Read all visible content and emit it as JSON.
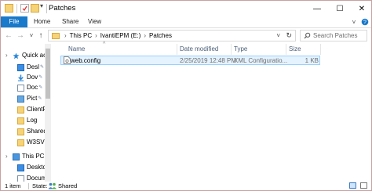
{
  "window": {
    "title": "Patches",
    "minimize": "—",
    "maximize": "☐",
    "close": "✕"
  },
  "ribbon": {
    "tabs": [
      "File",
      "Home",
      "Share",
      "View"
    ]
  },
  "address": {
    "back": "←",
    "forward": "→",
    "recent": "˅",
    "up": "↑",
    "crumbs": [
      "This PC",
      "IvantiEPM (E:)",
      "Patches"
    ],
    "dropdown": "˅",
    "refresh": "↻",
    "search_placeholder": "Search Patches"
  },
  "nav": {
    "items": [
      {
        "label": "Quick ac",
        "icon": "star-icon"
      },
      {
        "label": "Desl",
        "icon": "desktop-icon",
        "pinned": true
      },
      {
        "label": "Dov",
        "icon": "download-icon",
        "pinned": true
      },
      {
        "label": "Doc",
        "icon": "documents-icon",
        "pinned": true
      },
      {
        "label": "Pict",
        "icon": "pictures-icon",
        "pinned": true
      },
      {
        "label": "ClientP",
        "icon": "folder-icon"
      },
      {
        "label": "Log",
        "icon": "folder-icon"
      },
      {
        "label": "Shared",
        "icon": "folder-icon"
      },
      {
        "label": "W3SVC",
        "icon": "folder-icon"
      },
      {
        "label": "This PC",
        "icon": "computer-icon"
      },
      {
        "label": "Deskto",
        "icon": "desktop-icon"
      },
      {
        "label": "Docum",
        "icon": "documents-icon"
      }
    ],
    "pin_glyph": "✎"
  },
  "columns": [
    "Name",
    "Date modified",
    "Type",
    "Size"
  ],
  "files": [
    {
      "name": "web.config",
      "date": "2/25/2019 12:48 PM",
      "type": "XML Configuratio...",
      "size": "1 KB"
    }
  ],
  "status": {
    "count": "1 item",
    "state": "State:",
    "shared": "Shared"
  },
  "colors": {
    "accent": "#1979ca",
    "selection_bg": "#e5f3ff",
    "selection_border": "#99d1ff",
    "folder": "#f6d377"
  }
}
